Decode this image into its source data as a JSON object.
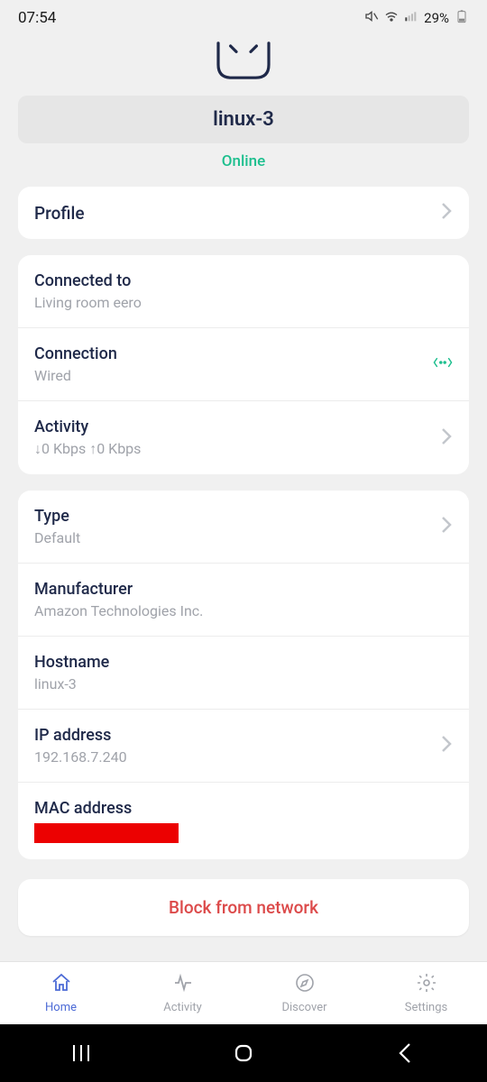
{
  "status_bar": {
    "time": "07:54",
    "battery": "29%"
  },
  "device": {
    "name": "linux-3",
    "status": "Online"
  },
  "profile_row": {
    "label": "Profile"
  },
  "connection_card": {
    "connected_to": {
      "label": "Connected to",
      "value": "Living room eero"
    },
    "connection": {
      "label": "Connection",
      "value": "Wired"
    },
    "activity": {
      "label": "Activity",
      "value": "↓0 Kbps ↑0 Kbps"
    }
  },
  "details_card": {
    "type": {
      "label": "Type",
      "value": "Default"
    },
    "manufacturer": {
      "label": "Manufacturer",
      "value": "Amazon Technologies Inc."
    },
    "hostname": {
      "label": "Hostname",
      "value": "linux-3"
    },
    "ip": {
      "label": "IP address",
      "value": "192.168.7.240"
    },
    "mac": {
      "label": "MAC address"
    }
  },
  "block_button": "Block from network",
  "nav": {
    "home": "Home",
    "activity": "Activity",
    "discover": "Discover",
    "settings": "Settings"
  }
}
